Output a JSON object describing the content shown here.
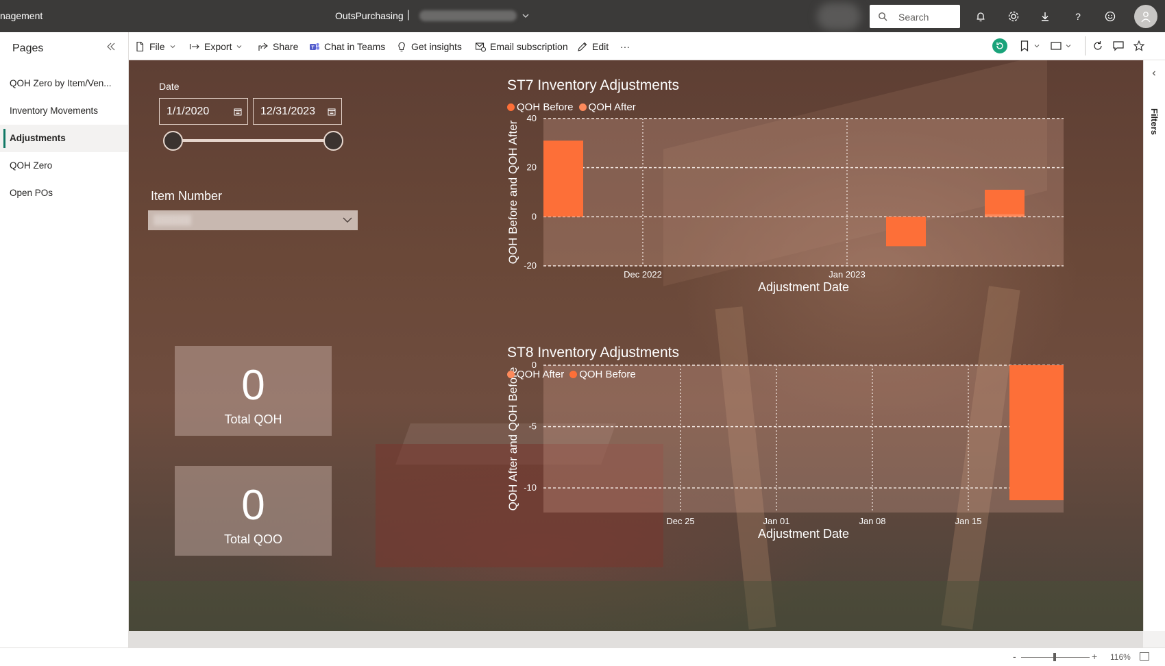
{
  "app": {
    "title": "nagement",
    "workspace": "OutsPurchasing",
    "separator": "|"
  },
  "search": {
    "placeholder": "Search"
  },
  "pages_pane": {
    "title": "Pages",
    "items": [
      {
        "label": "QOH Zero by Item/Ven..."
      },
      {
        "label": "Inventory Movements"
      },
      {
        "label": "Adjustments",
        "active": true
      },
      {
        "label": "QOH Zero"
      },
      {
        "label": "Open POs"
      }
    ]
  },
  "actions": {
    "file": "File",
    "export": "Export",
    "share": "Share",
    "chat": "Chat in Teams",
    "insights": "Get insights",
    "email": "Email subscription",
    "edit": "Edit",
    "more": "···"
  },
  "filters": {
    "date_label": "Date",
    "date_start": "1/1/2020",
    "date_end": "12/31/2023",
    "range_start_fraction": 0.0,
    "range_end_fraction": 1.0,
    "item_label": "Item Number"
  },
  "cards": [
    {
      "value": "0",
      "label": "Total QOH"
    },
    {
      "value": "0",
      "label": "Total QOO"
    }
  ],
  "filters_pane_label": "Filters",
  "zoom": "116%",
  "colors": {
    "accent_orange": "#fd6f38",
    "topbar": "#3b3a39",
    "page_active_marker": "#117865"
  },
  "chart_data": [
    {
      "type": "bar",
      "title": "ST7 Inventory Adjustments",
      "legend": [
        "QOH Before",
        "QOH After"
      ],
      "xlabel": "Adjustment Date",
      "ylabel": "QOH Before and QOH After",
      "ylim": [
        -20,
        40
      ],
      "yticks": [
        "40",
        "20",
        "0",
        "-20"
      ],
      "xticks": [
        "Dec 2022",
        "Jan 2023"
      ],
      "series": [
        {
          "name": "QOH Before",
          "color": "#fd6f38",
          "points": [
            {
              "date": "Nov 2022",
              "value": 31
            },
            {
              "date": "Jan 2023",
              "value": -12
            },
            {
              "date": "Feb 2023",
              "value": 11
            }
          ]
        },
        {
          "name": "QOH After",
          "color": "#fd8a5c",
          "points": [
            {
              "date": "Feb 2023",
              "value": 1
            }
          ]
        }
      ]
    },
    {
      "type": "bar",
      "title": "ST8 Inventory Adjustments",
      "legend": [
        "QOH After",
        "QOH Before"
      ],
      "xlabel": "Adjustment Date",
      "ylabel": "QOH After and QOH Before",
      "ylim": [
        -12,
        0
      ],
      "yticks": [
        "0",
        "-5",
        "-10"
      ],
      "xticks": [
        "Dec 25",
        "Jan 01",
        "Jan 08",
        "Jan 15"
      ],
      "series": [
        {
          "name": "QOH After",
          "color": "#fd8a5c",
          "points": []
        },
        {
          "name": "QOH Before",
          "color": "#fd6f38",
          "points": [
            {
              "date": "Jan 19",
              "value": -11
            }
          ]
        }
      ]
    }
  ]
}
